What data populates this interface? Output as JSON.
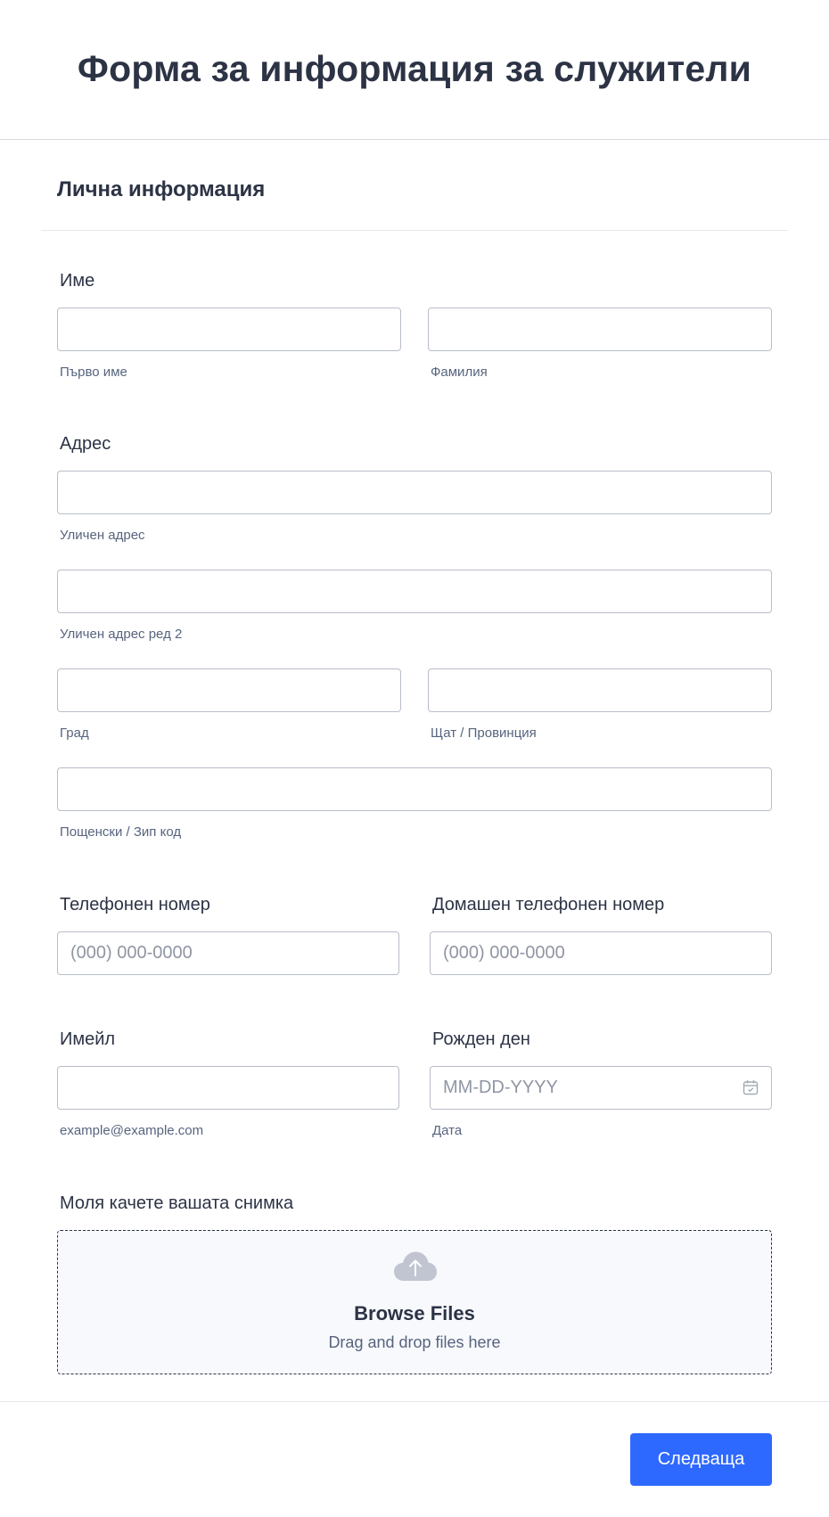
{
  "form": {
    "title": "Форма за информация за служители"
  },
  "section": {
    "title": "Лична информация"
  },
  "name_field": {
    "label": "Име",
    "first_sublabel": "Първо име",
    "last_sublabel": "Фамилия"
  },
  "address_field": {
    "label": "Адрес",
    "street_sublabel": "Уличен адрес",
    "street2_sublabel": "Уличен адрес ред 2",
    "city_sublabel": "Град",
    "state_sublabel": "Щат / Провинция",
    "zip_sublabel": "Пощенски / Зип код"
  },
  "phone_field": {
    "label": "Телефонен номер",
    "placeholder": "(000) 000-0000"
  },
  "home_phone_field": {
    "label": "Домашен телефонен номер",
    "placeholder": "(000) 000-0000"
  },
  "email_field": {
    "label": "Имейл",
    "sublabel": "example@example.com"
  },
  "birthday_field": {
    "label": "Рожден ден",
    "placeholder": "MM-DD-YYYY",
    "sublabel": "Дата",
    "icon": "calendar-icon"
  },
  "upload_field": {
    "label": "Моля качете вашата снимка",
    "browse_label": "Browse Files",
    "drag_hint": "Drag and drop files here",
    "icon": "cloud-upload-icon"
  },
  "actions": {
    "next_label": "Следваща"
  },
  "colors": {
    "primary": "#2e69ff",
    "text": "#2c3345",
    "sublabel": "#57647e",
    "border": "#b8bdc9"
  }
}
